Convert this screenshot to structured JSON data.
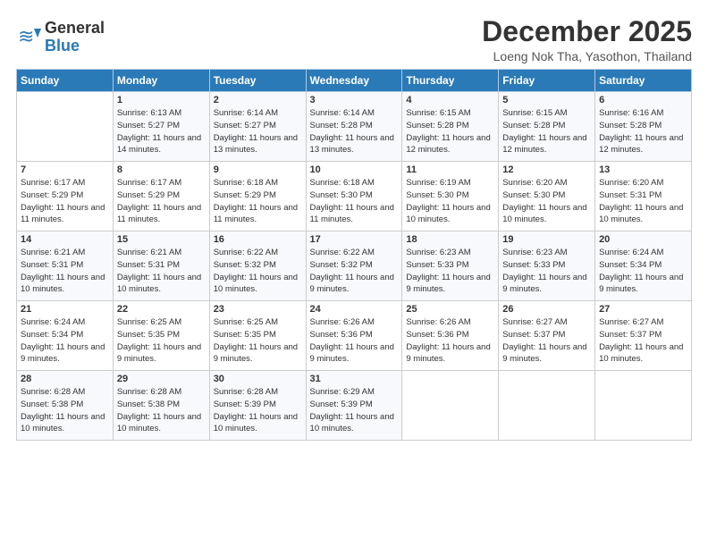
{
  "logo": {
    "general": "General",
    "blue": "Blue"
  },
  "title": "December 2025",
  "subtitle": "Loeng Nok Tha, Yasothon, Thailand",
  "days_of_week": [
    "Sunday",
    "Monday",
    "Tuesday",
    "Wednesday",
    "Thursday",
    "Friday",
    "Saturday"
  ],
  "weeks": [
    [
      {
        "day": "",
        "sunrise": "",
        "sunset": "",
        "daylight": ""
      },
      {
        "day": "1",
        "sunrise": "Sunrise: 6:13 AM",
        "sunset": "Sunset: 5:27 PM",
        "daylight": "Daylight: 11 hours and 14 minutes."
      },
      {
        "day": "2",
        "sunrise": "Sunrise: 6:14 AM",
        "sunset": "Sunset: 5:27 PM",
        "daylight": "Daylight: 11 hours and 13 minutes."
      },
      {
        "day": "3",
        "sunrise": "Sunrise: 6:14 AM",
        "sunset": "Sunset: 5:28 PM",
        "daylight": "Daylight: 11 hours and 13 minutes."
      },
      {
        "day": "4",
        "sunrise": "Sunrise: 6:15 AM",
        "sunset": "Sunset: 5:28 PM",
        "daylight": "Daylight: 11 hours and 12 minutes."
      },
      {
        "day": "5",
        "sunrise": "Sunrise: 6:15 AM",
        "sunset": "Sunset: 5:28 PM",
        "daylight": "Daylight: 11 hours and 12 minutes."
      },
      {
        "day": "6",
        "sunrise": "Sunrise: 6:16 AM",
        "sunset": "Sunset: 5:28 PM",
        "daylight": "Daylight: 11 hours and 12 minutes."
      }
    ],
    [
      {
        "day": "7",
        "sunrise": "Sunrise: 6:17 AM",
        "sunset": "Sunset: 5:29 PM",
        "daylight": "Daylight: 11 hours and 11 minutes."
      },
      {
        "day": "8",
        "sunrise": "Sunrise: 6:17 AM",
        "sunset": "Sunset: 5:29 PM",
        "daylight": "Daylight: 11 hours and 11 minutes."
      },
      {
        "day": "9",
        "sunrise": "Sunrise: 6:18 AM",
        "sunset": "Sunset: 5:29 PM",
        "daylight": "Daylight: 11 hours and 11 minutes."
      },
      {
        "day": "10",
        "sunrise": "Sunrise: 6:18 AM",
        "sunset": "Sunset: 5:30 PM",
        "daylight": "Daylight: 11 hours and 11 minutes."
      },
      {
        "day": "11",
        "sunrise": "Sunrise: 6:19 AM",
        "sunset": "Sunset: 5:30 PM",
        "daylight": "Daylight: 11 hours and 10 minutes."
      },
      {
        "day": "12",
        "sunrise": "Sunrise: 6:20 AM",
        "sunset": "Sunset: 5:30 PM",
        "daylight": "Daylight: 11 hours and 10 minutes."
      },
      {
        "day": "13",
        "sunrise": "Sunrise: 6:20 AM",
        "sunset": "Sunset: 5:31 PM",
        "daylight": "Daylight: 11 hours and 10 minutes."
      }
    ],
    [
      {
        "day": "14",
        "sunrise": "Sunrise: 6:21 AM",
        "sunset": "Sunset: 5:31 PM",
        "daylight": "Daylight: 11 hours and 10 minutes."
      },
      {
        "day": "15",
        "sunrise": "Sunrise: 6:21 AM",
        "sunset": "Sunset: 5:31 PM",
        "daylight": "Daylight: 11 hours and 10 minutes."
      },
      {
        "day": "16",
        "sunrise": "Sunrise: 6:22 AM",
        "sunset": "Sunset: 5:32 PM",
        "daylight": "Daylight: 11 hours and 10 minutes."
      },
      {
        "day": "17",
        "sunrise": "Sunrise: 6:22 AM",
        "sunset": "Sunset: 5:32 PM",
        "daylight": "Daylight: 11 hours and 9 minutes."
      },
      {
        "day": "18",
        "sunrise": "Sunrise: 6:23 AM",
        "sunset": "Sunset: 5:33 PM",
        "daylight": "Daylight: 11 hours and 9 minutes."
      },
      {
        "day": "19",
        "sunrise": "Sunrise: 6:23 AM",
        "sunset": "Sunset: 5:33 PM",
        "daylight": "Daylight: 11 hours and 9 minutes."
      },
      {
        "day": "20",
        "sunrise": "Sunrise: 6:24 AM",
        "sunset": "Sunset: 5:34 PM",
        "daylight": "Daylight: 11 hours and 9 minutes."
      }
    ],
    [
      {
        "day": "21",
        "sunrise": "Sunrise: 6:24 AM",
        "sunset": "Sunset: 5:34 PM",
        "daylight": "Daylight: 11 hours and 9 minutes."
      },
      {
        "day": "22",
        "sunrise": "Sunrise: 6:25 AM",
        "sunset": "Sunset: 5:35 PM",
        "daylight": "Daylight: 11 hours and 9 minutes."
      },
      {
        "day": "23",
        "sunrise": "Sunrise: 6:25 AM",
        "sunset": "Sunset: 5:35 PM",
        "daylight": "Daylight: 11 hours and 9 minutes."
      },
      {
        "day": "24",
        "sunrise": "Sunrise: 6:26 AM",
        "sunset": "Sunset: 5:36 PM",
        "daylight": "Daylight: 11 hours and 9 minutes."
      },
      {
        "day": "25",
        "sunrise": "Sunrise: 6:26 AM",
        "sunset": "Sunset: 5:36 PM",
        "daylight": "Daylight: 11 hours and 9 minutes."
      },
      {
        "day": "26",
        "sunrise": "Sunrise: 6:27 AM",
        "sunset": "Sunset: 5:37 PM",
        "daylight": "Daylight: 11 hours and 9 minutes."
      },
      {
        "day": "27",
        "sunrise": "Sunrise: 6:27 AM",
        "sunset": "Sunset: 5:37 PM",
        "daylight": "Daylight: 11 hours and 10 minutes."
      }
    ],
    [
      {
        "day": "28",
        "sunrise": "Sunrise: 6:28 AM",
        "sunset": "Sunset: 5:38 PM",
        "daylight": "Daylight: 11 hours and 10 minutes."
      },
      {
        "day": "29",
        "sunrise": "Sunrise: 6:28 AM",
        "sunset": "Sunset: 5:38 PM",
        "daylight": "Daylight: 11 hours and 10 minutes."
      },
      {
        "day": "30",
        "sunrise": "Sunrise: 6:28 AM",
        "sunset": "Sunset: 5:39 PM",
        "daylight": "Daylight: 11 hours and 10 minutes."
      },
      {
        "day": "31",
        "sunrise": "Sunrise: 6:29 AM",
        "sunset": "Sunset: 5:39 PM",
        "daylight": "Daylight: 11 hours and 10 minutes."
      },
      {
        "day": "",
        "sunrise": "",
        "sunset": "",
        "daylight": ""
      },
      {
        "day": "",
        "sunrise": "",
        "sunset": "",
        "daylight": ""
      },
      {
        "day": "",
        "sunrise": "",
        "sunset": "",
        "daylight": ""
      }
    ]
  ]
}
